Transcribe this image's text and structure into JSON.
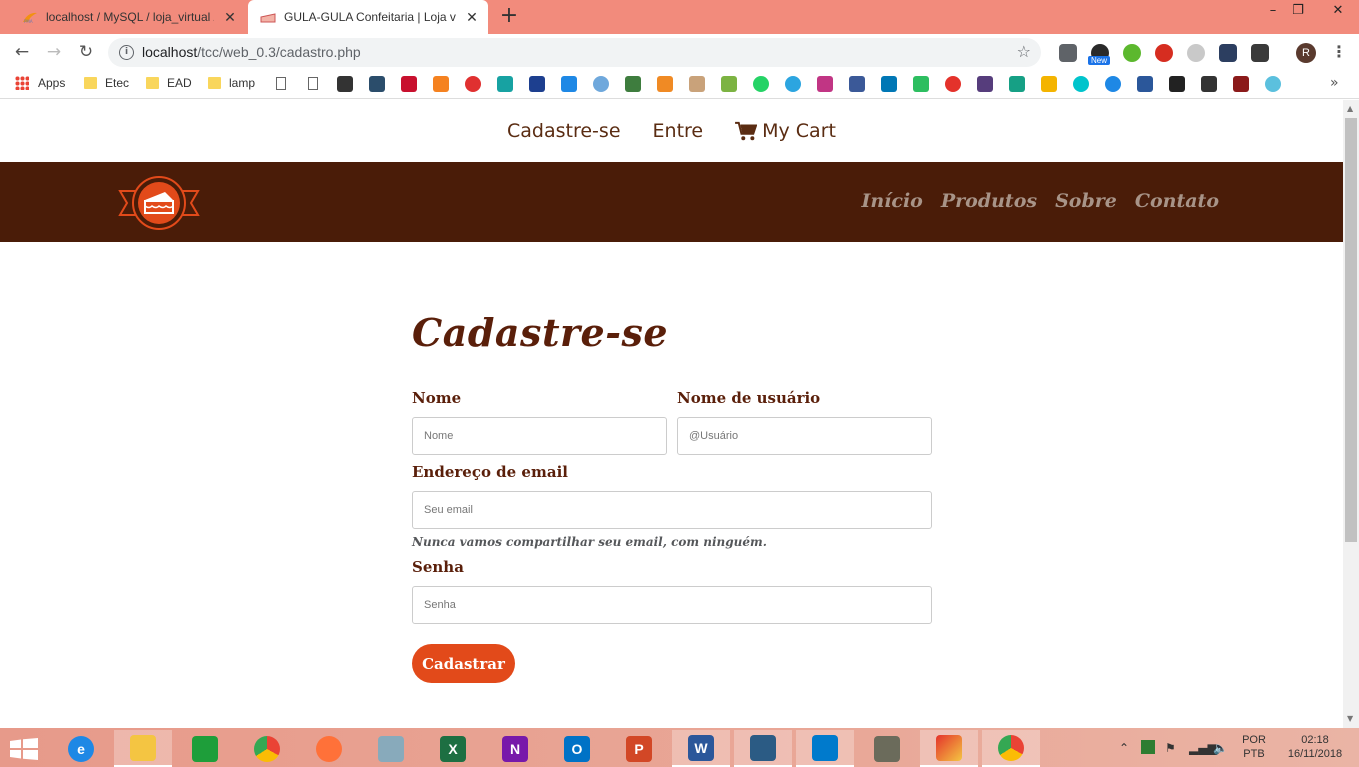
{
  "browser": {
    "tabs": [
      {
        "title": "localhost / MySQL / loja_virtual /",
        "active": false
      },
      {
        "title": "GULA-GULA Confeitaria | Loja vir",
        "active": true
      }
    ],
    "new_tab": "+",
    "window_controls": {
      "minimize": "–",
      "restore": "❐",
      "close": "✕"
    },
    "nav": {
      "back": "←",
      "forward": "→",
      "reload": "↻"
    },
    "url_host": "localhost",
    "url_path": "/tcc/web_0.3/cadastro.php",
    "info_icon": "i",
    "star": "☆",
    "extension_badge": "New",
    "profile_initial": "R",
    "menu": "⋮"
  },
  "bookmarks": {
    "apps": "Apps",
    "folders": [
      "Etec",
      "EAD",
      "lamp"
    ],
    "more": "»"
  },
  "site": {
    "top_nav": {
      "signup": "Cadastre-se",
      "login": "Entre",
      "cart": "My Cart"
    },
    "main_nav": [
      "Início",
      "Produtos",
      "Sobre",
      "Contato"
    ],
    "colors": {
      "header_bg": "#4a1c08",
      "brand_text": "#5a1f0a",
      "accent": "#e24a1a"
    }
  },
  "form": {
    "title": "Cadastre-se",
    "name_label": "Nome",
    "name_placeholder": "Nome",
    "username_label": "Nome de usuário",
    "username_placeholder": "@Usuário",
    "email_label": "Endereço de email",
    "email_placeholder": "Seu email",
    "email_help": "Nunca vamos compartilhar seu email, com ninguém.",
    "password_label": "Senha",
    "password_placeholder": "Senha",
    "submit": "Cadastrar"
  },
  "taskbar": {
    "language_top": "POR",
    "language_bottom": "PTB",
    "time": "02:18",
    "date": "16/11/2018"
  }
}
